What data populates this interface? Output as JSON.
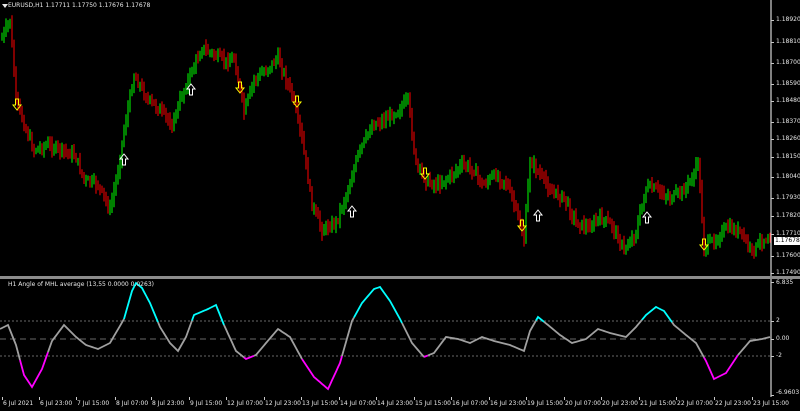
{
  "symbol_header": "EURUSD,H1  1.17711 1.17750 1.17676 1.17678",
  "current_price": "1.17678",
  "indicator_header": "H1 Angle of MHL average (13,55 0.0000 0.0263)",
  "colors": {
    "bull_candle": "#00ff00",
    "bear_candle": "#ff0000",
    "up_arrow": "#ffffff",
    "down_arrow": "#ffff00",
    "indicator_up": "#00ffff",
    "indicator_down": "#ff00ff",
    "indicator_neutral": "#a0a0a0"
  },
  "price_axis": [
    "1.18920",
    "1.18810",
    "1.18700",
    "1.18590",
    "1.18480",
    "1.18370",
    "1.18260",
    "1.18150",
    "1.18040",
    "1.17930",
    "1.17820",
    "1.17710",
    "1.17600",
    "1.17490"
  ],
  "indicator_axis": [
    "6.835",
    "2",
    "0.00",
    "-2",
    "-6.9603"
  ],
  "time_axis": [
    "6 Jul 2021",
    "6 Jul 23:00",
    "7 Jul 15:00",
    "8 Jul 07:00",
    "8 Jul 23:00",
    "9 Jul 15:00",
    "12 Jul 07:00",
    "12 Jul 23:00",
    "13 Jul 15:00",
    "14 Jul 07:00",
    "14 Jul 23:00",
    "15 Jul 15:00",
    "16 Jul 07:00",
    "16 Jul 23:00",
    "19 Jul 15:00",
    "20 Jul 07:00",
    "20 Jul 23:00",
    "21 Jul 15:00",
    "22 Jul 07:00",
    "22 Jul 23:00",
    "23 Jul 15:00"
  ],
  "price_chart_data": {
    "type": "candlestick",
    "series": [
      {
        "label": "6 Jul 2021",
        "close": 1.1887
      },
      {
        "label": "6 Jul 23:00",
        "close": 1.1822
      },
      {
        "label": "7 Jul 15:00",
        "close": 1.18
      },
      {
        "label": "8 Jul 07:00",
        "close": 1.1812
      },
      {
        "label": "8 Jul 23:00",
        "close": 1.1845
      },
      {
        "label": "9 Jul 15:00",
        "close": 1.1876
      },
      {
        "label": "12 Jul 07:00",
        "close": 1.186
      },
      {
        "label": "12 Jul 23:00",
        "close": 1.187
      },
      {
        "label": "13 Jul 15:00",
        "close": 1.1825
      },
      {
        "label": "14 Jul 07:00",
        "close": 1.178
      },
      {
        "label": "14 Jul 23:00",
        "close": 1.1818
      },
      {
        "label": "15 Jul 15:00",
        "close": 1.1845
      },
      {
        "label": "16 Jul 07:00",
        "close": 1.1808
      },
      {
        "label": "16 Jul 23:00",
        "close": 1.1811
      },
      {
        "label": "19 Jul 15:00",
        "close": 1.1798
      },
      {
        "label": "20 Jul 07:00",
        "close": 1.1788
      },
      {
        "label": "20 Jul 23:00",
        "close": 1.178
      },
      {
        "label": "21 Jul 15:00",
        "close": 1.1772
      },
      {
        "label": "22 Jul 07:00",
        "close": 1.1795
      },
      {
        "label": "22 Jul 23:00",
        "close": 1.1768
      },
      {
        "label": "23 Jul 15:00",
        "close": 1.177
      }
    ],
    "ylim": [
      1.1749,
      1.1892
    ]
  },
  "indicator_chart_data": {
    "type": "line",
    "levels": [
      2,
      0,
      -2
    ],
    "ylim": [
      -6.9603,
      6.835
    ]
  }
}
